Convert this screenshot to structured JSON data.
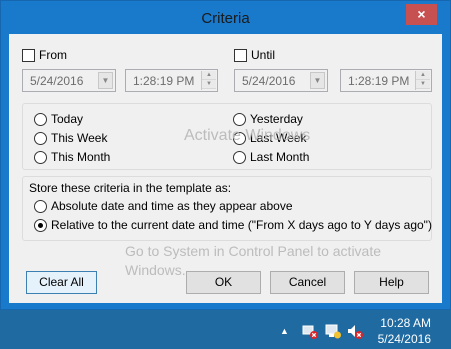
{
  "dialog": {
    "title": "Criteria",
    "close_glyph": "×"
  },
  "range": {
    "from_label": "From",
    "until_label": "Until",
    "from_date": "5/24/2016",
    "from_time": "1:28:19 PM",
    "until_date": "5/24/2016",
    "until_time": "1:28:19 PM"
  },
  "presets": {
    "today": "Today",
    "this_week": "This Week",
    "this_month": "This Month",
    "yesterday": "Yesterday",
    "last_week": "Last Week",
    "last_month": "Last Month"
  },
  "store": {
    "caption": "Store these criteria in the template as:",
    "absolute": "Absolute date and time as they appear above",
    "relative": "Relative to the current date and time (\"From X days ago to Y days ago\")",
    "selected": "relative"
  },
  "buttons": {
    "clear_all": "Clear All",
    "ok": "OK",
    "cancel": "Cancel",
    "help": "Help"
  },
  "watermark": {
    "line1": "Activate Windows",
    "line2": "Go to System in Control Panel to activate",
    "line3": "Windows."
  },
  "taskbar": {
    "time": "10:28 AM",
    "date": "5/24/2016",
    "icons": [
      "show-hidden-icons-icon",
      "network-error-icon",
      "action-center-icon",
      "volume-muted-icon"
    ]
  },
  "colors": {
    "titlebar": "#1979ca",
    "close": "#c75050",
    "taskbar": "#1e6aa1"
  }
}
